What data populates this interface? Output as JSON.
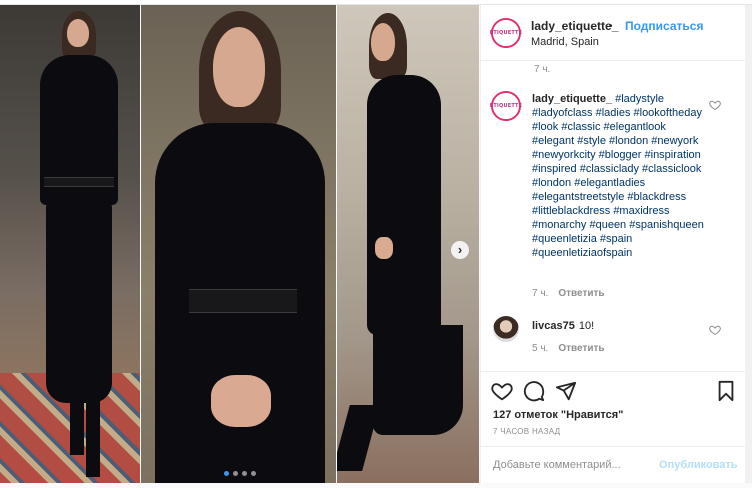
{
  "post": {
    "username": "lady_etiquette_",
    "separator": "•",
    "follow_label": "Подписаться",
    "location": "Madrid, Spain",
    "avatar_logo_text": "ÉTIQUETTE"
  },
  "comments": {
    "top_time": "7 ч.",
    "caption_username": "lady_etiquette_",
    "caption_text": "#ladystyle #ladyofclass #ladies #lookoftheday #look #classic #elegantlook #elegant #style #london #newyork #newyorkcity #blogger #inspiration #inspired #classiclady #classiclook #london #elegantladies #elegantstreetstyle #blackdress #littleblackdress #maxidress #monarchy #queen #spanishqueen #queenletizia #spain #queenletiziaofspain",
    "caption_time": "7 ч.",
    "reply_label": "Ответить",
    "second_username": "livcas75",
    "second_text": "10!",
    "second_time": "5 ч."
  },
  "actions": {
    "likes": "127 отметок \"Нравится\"",
    "ago": "7 ЧАСОВ НАЗАД"
  },
  "add_comment": {
    "placeholder": "Добавьте комментарий...",
    "publish_label": "Опубликовать"
  },
  "carousel": {
    "slide_count": 4,
    "active_index": 0
  },
  "colors": {
    "accent": "#3897f0",
    "tag": "#003569",
    "muted": "#8e8e8e"
  }
}
